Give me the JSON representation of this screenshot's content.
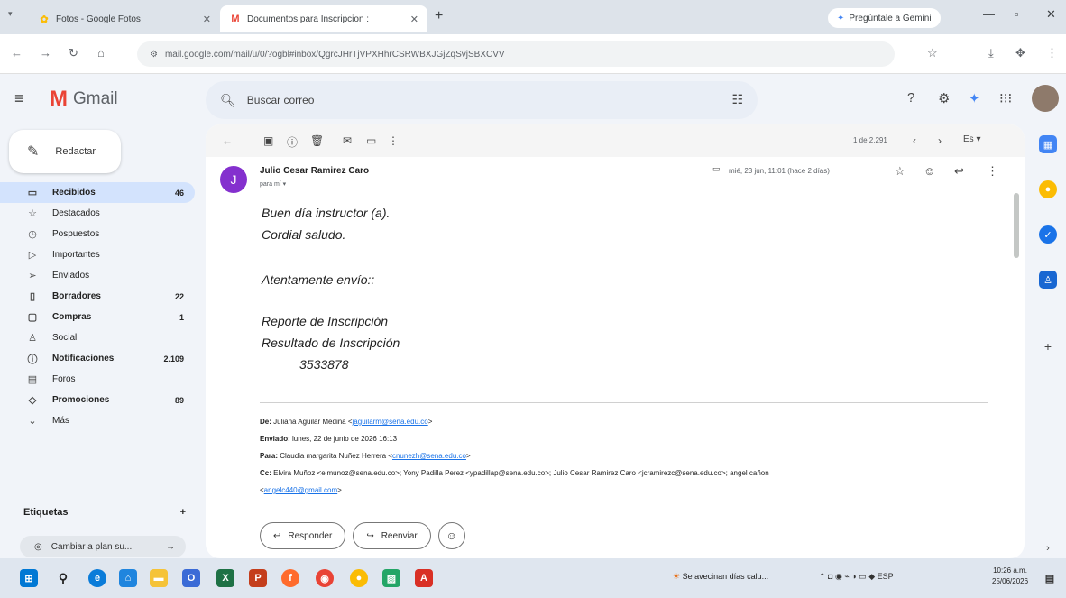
{
  "browser": {
    "tabs": [
      {
        "title": "Fotos - Google Fotos",
        "active": false
      },
      {
        "title": "Documentos para Inscripcion :",
        "active": true
      }
    ],
    "gemini_button": "Pregúntale a Gemini",
    "url": "mail.google.com/mail/u/0/?ogbl#inbox/QgrcJHrTjVPXHhrCSRWBXJGjZqSvjSBXCVV"
  },
  "gmail": {
    "brand": "Gmail",
    "search_placeholder": "Buscar correo",
    "compose_label": "Redactar",
    "nav": [
      {
        "label": "Recibidos",
        "count": "46",
        "icon": "inbox-icon",
        "glyph": "▭",
        "style": "active"
      },
      {
        "label": "Destacados",
        "count": "",
        "icon": "star-icon",
        "glyph": "☆",
        "style": ""
      },
      {
        "label": "Pospuestos",
        "count": "",
        "icon": "clock-icon",
        "glyph": "◷",
        "style": ""
      },
      {
        "label": "Importantes",
        "count": "",
        "icon": "important-icon",
        "glyph": "▷",
        "style": ""
      },
      {
        "label": "Enviados",
        "count": "",
        "icon": "send-icon",
        "glyph": "➢",
        "style": ""
      },
      {
        "label": "Borradores",
        "count": "22",
        "icon": "draft-icon",
        "glyph": "▯",
        "style": "bold"
      },
      {
        "label": "Compras",
        "count": "1",
        "icon": "shopping-icon",
        "glyph": "▢",
        "style": "bold"
      },
      {
        "label": "Social",
        "count": "",
        "icon": "people-icon",
        "glyph": "♙",
        "style": ""
      },
      {
        "label": "Notificaciones",
        "count": "2.109",
        "icon": "info-icon",
        "glyph": "ⓘ",
        "style": "bold"
      },
      {
        "label": "Foros",
        "count": "",
        "icon": "forum-icon",
        "glyph": "▤",
        "style": ""
      },
      {
        "label": "Promociones",
        "count": "89",
        "icon": "tag-icon",
        "glyph": "◇",
        "style": "bold"
      },
      {
        "label": "Más",
        "count": "",
        "icon": "chevron-down-icon",
        "glyph": "⌄",
        "style": ""
      }
    ],
    "labels_title": "Etiquetas",
    "upgrade_label": "Cambiar a plan su..."
  },
  "message": {
    "pager": "1 de 2.291",
    "sender_initial": "J",
    "sender_name": "Julio Cesar Ramirez Caro",
    "recipient": "para mí ▾",
    "date": "mié, 23 jun, 11:01 (hace 2 días)",
    "body_lines": [
      "Buen día instructor (a).",
      "Cordial saludo.",
      "Atentamente envío::",
      "Reporte de Inscripción",
      "Resultado de Inscripción",
      "3533878"
    ],
    "forward": {
      "from_label": "De:",
      "from_value": "Juliana Aguilar Medina <",
      "from_email": "jaguilarm@sena.edu.co",
      "sent_label": "Enviado:",
      "sent_value": "lunes, 22 de junio de 2026 16:13",
      "to_label": "Para:",
      "to_value": "Claudia margarita Nuñez Herrera <",
      "to_email": "cnunezh@sena.edu.co",
      "cc_label": "Cc:",
      "cc_value": "Elvira Muñoz <elmunoz@sena.edu.co>; Yony Padilla Perez <ypadillap@sena.edu.co>; Julio Cesar Ramirez Caro <jcramirezc@sena.edu.co>; angel cañon",
      "cc_email2": "angelc440@gmail.com"
    },
    "reply_label": "Responder",
    "forward_label": "Reenviar"
  },
  "taskbar": {
    "weather": "Se avecinan días calu...",
    "lang": "ESP",
    "time": "10:26 a.m.",
    "date": "25/06/2026"
  }
}
